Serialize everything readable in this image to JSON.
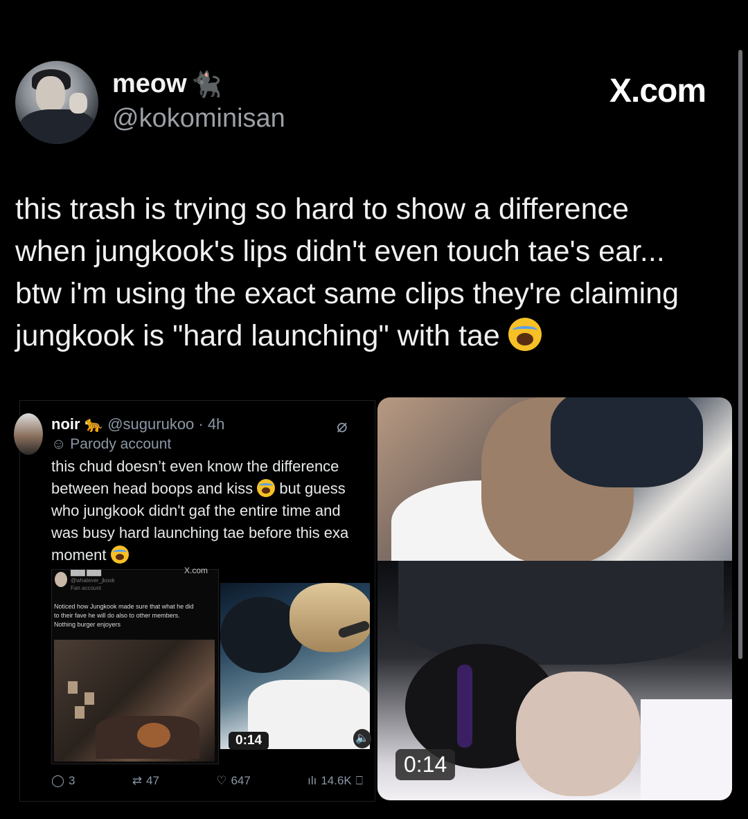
{
  "header": {
    "display_name": "meow",
    "name_icon": "cat-icon",
    "handle": "@kokominisan",
    "watermark": "X.com"
  },
  "tweet": {
    "text": "this trash is trying so hard to show a difference\nwhen jungkook's lips didn't even touch tae's ear...\nbtw i'm using the exact same clips they're claiming\njungkook is \"hard launching\" with tae ",
    "emoji": "loudly-crying-face"
  },
  "embedded_post": {
    "display_name": "noir",
    "name_icon": "leopard-icon",
    "handle_time": "@sugurukoo · 4h",
    "label": "Parody account",
    "text": "this chud doesn’t even know the difference\nbetween head boops and kiss ",
    "text_2": " but guess\nwho jungkook didn't gaf the entire time and\nwas busy hard launching tae before this exa\nmoment ",
    "quoted": {
      "handle": "@whatever_jkook",
      "label": "Fan account",
      "watermark": "X.com",
      "text": "Noticed how Jungkook made sure that what he did\nto their fave he will do also to other members.\nNothing burger enjoyers "
    },
    "video_duration": "0:14",
    "actions": {
      "replies": "3",
      "reposts": "47",
      "likes": "647",
      "views": "14.6K"
    }
  },
  "main_video": {
    "duration": "0:14"
  }
}
